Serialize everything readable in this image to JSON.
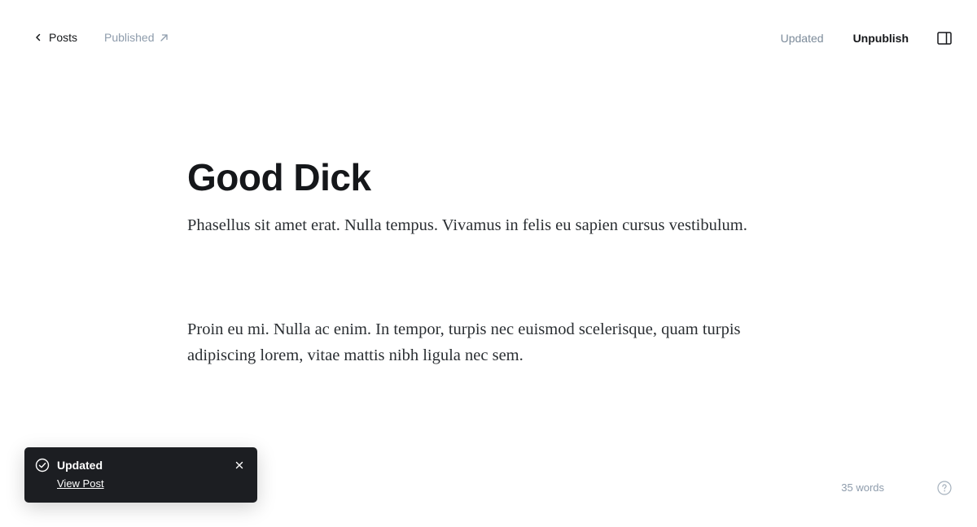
{
  "header": {
    "back_label": "Posts",
    "status_label": "Published",
    "save_status": "Updated",
    "unpublish_label": "Unpublish"
  },
  "post": {
    "title": "Good Dick",
    "paragraphs": [
      "Phasellus sit amet erat. Nulla tempus. Vivamus in felis eu sapien cursus vestibulum.",
      "Proin eu mi. Nulla ac enim. In tempor, turpis nec euismod scelerisque, quam turpis adipiscing lorem, vitae mattis nibh ligula nec sem."
    ]
  },
  "toast": {
    "title": "Updated",
    "link_label": "View Post"
  },
  "footer": {
    "word_count": "35 words"
  },
  "icons": {
    "back": "chevron-left-icon",
    "external": "arrow-up-right-icon",
    "sidebar": "sidebar-panel-icon",
    "toast_check": "check-circle-icon",
    "toast_close": "close-icon",
    "help": "question-circle-icon"
  },
  "colors": {
    "text": "#15171a",
    "muted": "#8e9cac",
    "toast_bg": "#1c1e22"
  }
}
